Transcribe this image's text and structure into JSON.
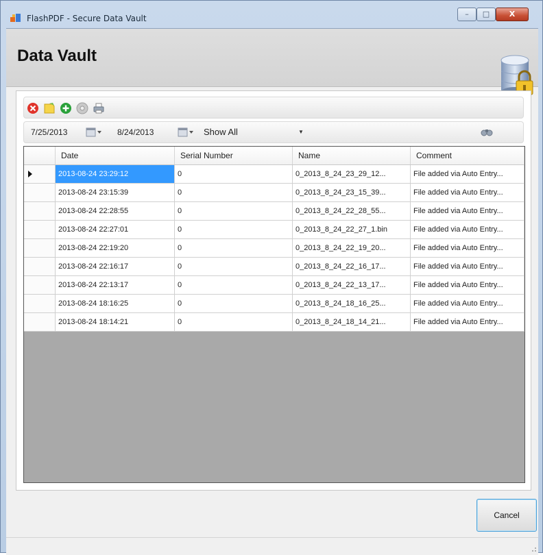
{
  "window": {
    "title": "FlashPDF - Secure Data Vault",
    "minimize_label": "–",
    "maximize_label": "□",
    "close_label": "X"
  },
  "header": {
    "title": "Data Vault",
    "icon": "database-lock-icon"
  },
  "toolbar": {
    "buttons": [
      {
        "name": "delete-button",
        "icon": "red-x-icon"
      },
      {
        "name": "comment-button",
        "icon": "note-icon"
      },
      {
        "name": "add-button",
        "icon": "green-plus-icon"
      },
      {
        "name": "disc-button",
        "icon": "disc-icon"
      },
      {
        "name": "print-button",
        "icon": "printer-icon"
      }
    ]
  },
  "filter": {
    "start_date": "7/25/2013",
    "end_date": "8/24/2013",
    "show_value": "Show All"
  },
  "grid": {
    "columns": [
      "Date",
      "Serial Number",
      "Name",
      "Comment"
    ],
    "rows": [
      {
        "date": "2013-08-24 23:29:12",
        "serial": "0",
        "name": "0_2013_8_24_23_29_12...",
        "comment": "File added via Auto Entry..."
      },
      {
        "date": "2013-08-24 23:15:39",
        "serial": "0",
        "name": "0_2013_8_24_23_15_39...",
        "comment": "File added via Auto Entry..."
      },
      {
        "date": "2013-08-24 22:28:55",
        "serial": "0",
        "name": "0_2013_8_24_22_28_55...",
        "comment": "File added via Auto Entry..."
      },
      {
        "date": "2013-08-24 22:27:01",
        "serial": "0",
        "name": "0_2013_8_24_22_27_1.bin",
        "comment": "File added via Auto Entry..."
      },
      {
        "date": "2013-08-24 22:19:20",
        "serial": "0",
        "name": "0_2013_8_24_22_19_20...",
        "comment": "File added via Auto Entry..."
      },
      {
        "date": "2013-08-24 22:16:17",
        "serial": "0",
        "name": "0_2013_8_24_22_16_17...",
        "comment": "File added via Auto Entry..."
      },
      {
        "date": "2013-08-24 22:13:17",
        "serial": "0",
        "name": "0_2013_8_24_22_13_17...",
        "comment": "File added via Auto Entry..."
      },
      {
        "date": "2013-08-24 18:16:25",
        "serial": "0",
        "name": "0_2013_8_24_18_16_25...",
        "comment": "File added via Auto Entry..."
      },
      {
        "date": "2013-08-24 18:14:21",
        "serial": "0",
        "name": "0_2013_8_24_18_14_21...",
        "comment": "File added via Auto Entry..."
      }
    ]
  },
  "footer": {
    "cancel_label": "Cancel"
  },
  "colors": {
    "selection": "#3399ff",
    "grid_background": "#a9a9a9",
    "header_background": "#d9d9d9"
  }
}
